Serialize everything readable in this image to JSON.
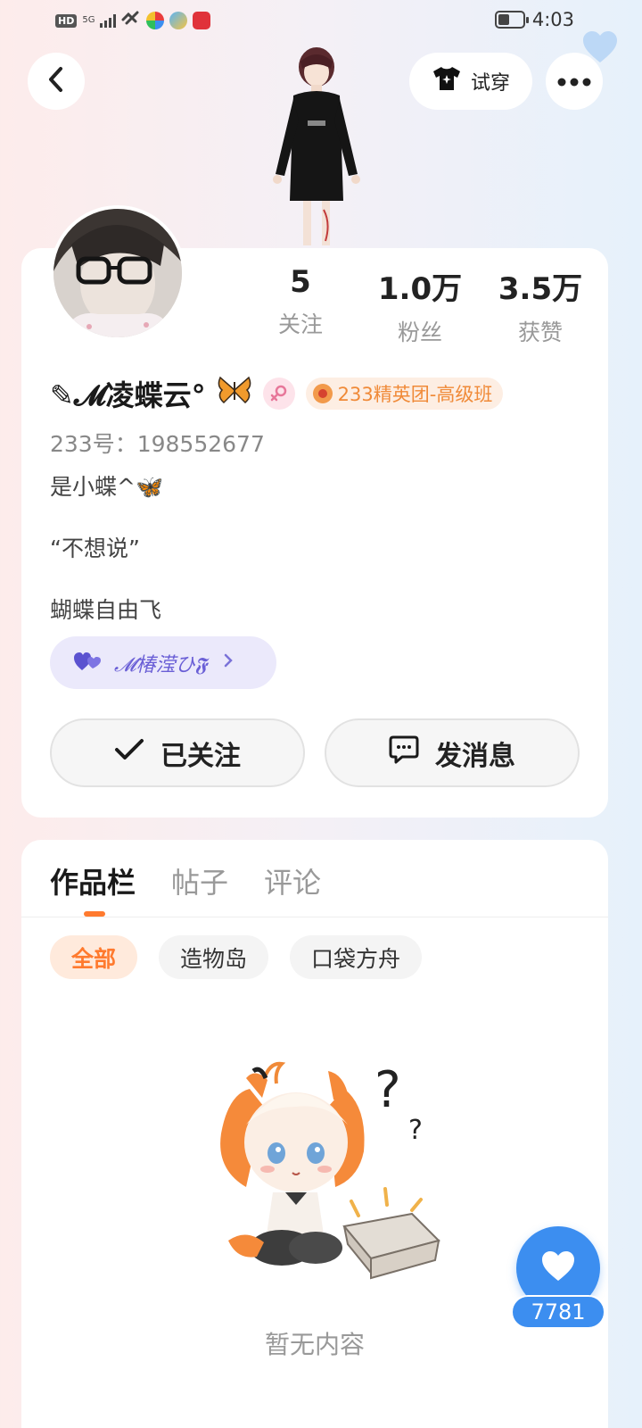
{
  "status_bar": {
    "hd": "HD",
    "network": "5G",
    "time": "4:03"
  },
  "top_nav": {
    "tryon_label": "试穿"
  },
  "profile": {
    "stats": [
      {
        "value": "5",
        "label": "关注"
      },
      {
        "value": "1.0万",
        "label": "粉丝"
      },
      {
        "value": "3.5万",
        "label": "获赞"
      }
    ],
    "nickname": "✎𝓜凌蝶云°",
    "badge_label": "233精英团-高级班",
    "uid": "233号：198552677",
    "bio_lines": [
      "是小蝶^🦋",
      "“不想说”",
      "蝴蝶自由飞"
    ],
    "couple_name": "𝓜椿滢ひ𝕱",
    "follow_label": "已关注",
    "message_label": "发消息"
  },
  "works": {
    "tabs": [
      "作品栏",
      "帖子",
      "评论"
    ],
    "filters": [
      "全部",
      "造物岛",
      "口袋方舟"
    ],
    "empty_text": "暂无内容"
  },
  "like_fab": {
    "count": "7781"
  },
  "colors": {
    "accent_orange": "#ff7a2e",
    "like_blue": "#3c8ef0",
    "couple_purple": "#6a5fd6"
  }
}
